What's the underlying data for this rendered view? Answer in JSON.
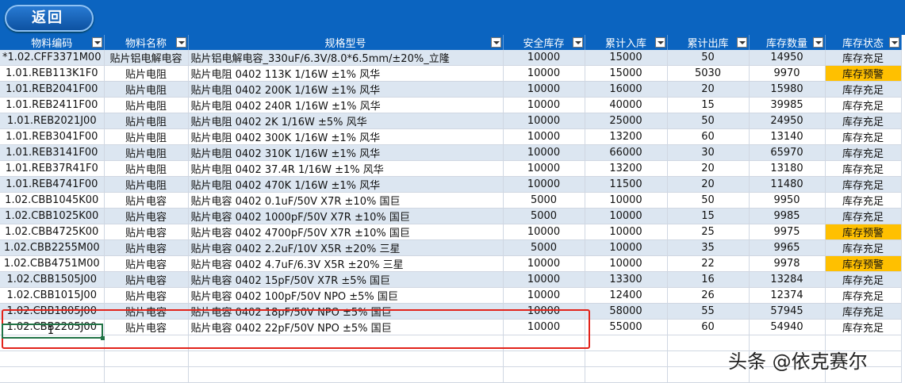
{
  "header": {
    "back_label": "返回"
  },
  "table": {
    "columns": [
      "物料编码",
      "物料名称",
      "规格型号",
      "安全库存",
      "累计入库",
      "累计出库",
      "库存数量",
      "库存状态"
    ],
    "rows": [
      {
        "code": "*1.02.CFF3371M00",
        "name": "贴片铝电解电容",
        "spec": "贴片铝电解电容_330uF/6.3V/8.0*6.5mm/±20%_立隆",
        "safe": "10000",
        "in": "15000",
        "out": "50",
        "qty": "14950",
        "status": "库存充足",
        "warn": false
      },
      {
        "code": "1.01.REB113K1F0",
        "name": "贴片电阻",
        "spec": "贴片电阻 0402 113K 1/16W ±1% 风华",
        "safe": "10000",
        "in": "15000",
        "out": "5030",
        "qty": "9970",
        "status": "库存预警",
        "warn": true
      },
      {
        "code": "1.01.REB2041F00",
        "name": "贴片电阻",
        "spec": "贴片电阻 0402 200K 1/16W ±1% 风华",
        "safe": "10000",
        "in": "16000",
        "out": "20",
        "qty": "15980",
        "status": "库存充足",
        "warn": false
      },
      {
        "code": "1.01.REB2411F00",
        "name": "贴片电阻",
        "spec": "贴片电阻 0402 240R 1/16W ±1% 风华",
        "safe": "10000",
        "in": "40000",
        "out": "15",
        "qty": "39985",
        "status": "库存充足",
        "warn": false
      },
      {
        "code": "1.01.REB2021J00",
        "name": "贴片电阻",
        "spec": "贴片电阻 0402 2K 1/16W ±5%  风华",
        "safe": "10000",
        "in": "25000",
        "out": "50",
        "qty": "24950",
        "status": "库存充足",
        "warn": false
      },
      {
        "code": "1.01.REB3041F00",
        "name": "贴片电阻",
        "spec": "贴片电阻 0402 300K 1/16W ±1% 风华",
        "safe": "10000",
        "in": "13200",
        "out": "60",
        "qty": "13140",
        "status": "库存充足",
        "warn": false
      },
      {
        "code": "1.01.REB3141F00",
        "name": "贴片电阻",
        "spec": "贴片电阻 0402 310K 1/16W ±1% 风华",
        "safe": "10000",
        "in": "66000",
        "out": "30",
        "qty": "65970",
        "status": "库存充足",
        "warn": false
      },
      {
        "code": "1.01.REB37R41F0",
        "name": "贴片电阻",
        "spec": "贴片电阻 0402 37.4R 1/16W ±1%  风华",
        "safe": "10000",
        "in": "13200",
        "out": "20",
        "qty": "13180",
        "status": "库存充足",
        "warn": false
      },
      {
        "code": "1.01.REB4741F00",
        "name": "贴片电阻",
        "spec": "贴片电阻 0402 470K 1/16W ±1%  风华",
        "safe": "10000",
        "in": "11500",
        "out": "20",
        "qty": "11480",
        "status": "库存充足",
        "warn": false
      },
      {
        "code": "1.02.CBB1045K00",
        "name": "贴片电容",
        "spec": "贴片电容 0402 0.1uF/50V X7R ±10% 国巨",
        "safe": "5000",
        "in": "10000",
        "out": "50",
        "qty": "9950",
        "status": "库存充足",
        "warn": false
      },
      {
        "code": "1.02.CBB1025K00",
        "name": "贴片电容",
        "spec": "贴片电容 0402 1000pF/50V X7R ±10% 国巨",
        "safe": "5000",
        "in": "10000",
        "out": "15",
        "qty": "9985",
        "status": "库存充足",
        "warn": false
      },
      {
        "code": "1.02.CBB4725K00",
        "name": "贴片电容",
        "spec": "贴片电容 0402 4700pF/50V X7R ±10% 国巨",
        "safe": "10000",
        "in": "10000",
        "out": "25",
        "qty": "9975",
        "status": "库存预警",
        "warn": true
      },
      {
        "code": "1.02.CBB2255M00",
        "name": "贴片电容",
        "spec": "贴片电容 0402 2.2uF/10V X5R ±20%  三星",
        "safe": "5000",
        "in": "10000",
        "out": "35",
        "qty": "9965",
        "status": "库存充足",
        "warn": false
      },
      {
        "code": "1.02.CBB4751M00",
        "name": "贴片电容",
        "spec": "贴片电容 0402 4.7uF/6.3V X5R ±20% 三星",
        "safe": "10000",
        "in": "10000",
        "out": "22",
        "qty": "9978",
        "status": "库存预警",
        "warn": true
      },
      {
        "code": "1.02.CBB1505J00",
        "name": "贴片电容",
        "spec": "贴片电容 0402 15pF/50V X7R ±5% 国巨",
        "safe": "10000",
        "in": "13300",
        "out": "16",
        "qty": "13284",
        "status": "库存充足",
        "warn": false
      },
      {
        "code": "1.02.CBB1015J00",
        "name": "贴片电容",
        "spec": "贴片电容 0402 100pF/50V NPO ±5% 国巨",
        "safe": "10000",
        "in": "12400",
        "out": "26",
        "qty": "12374",
        "status": "库存充足",
        "warn": false
      },
      {
        "code": "1.02.CBB1805J00",
        "name": "贴片电容",
        "spec": "贴片电容 0402 18pF/50V NPO ±5% 国巨",
        "safe": "10000",
        "in": "58000",
        "out": "55",
        "qty": "57945",
        "status": "库存充足",
        "warn": false
      },
      {
        "code": "1.02.CBB2205J00",
        "name": "贴片电容",
        "spec": "贴片电容 0402 22pF/50V NPO ±5% 国巨",
        "safe": "10000",
        "in": "55000",
        "out": "60",
        "qty": "54940",
        "status": "库存充足",
        "warn": false
      }
    ]
  },
  "active_cell": {
    "value": "1"
  },
  "watermark": "头条 @依克赛尔",
  "colors": {
    "header_bg": "#0b64c0",
    "band": "#dce6f1",
    "warn": "#ffc000",
    "highlight_box": "#e2231a",
    "selection": "#217346"
  }
}
